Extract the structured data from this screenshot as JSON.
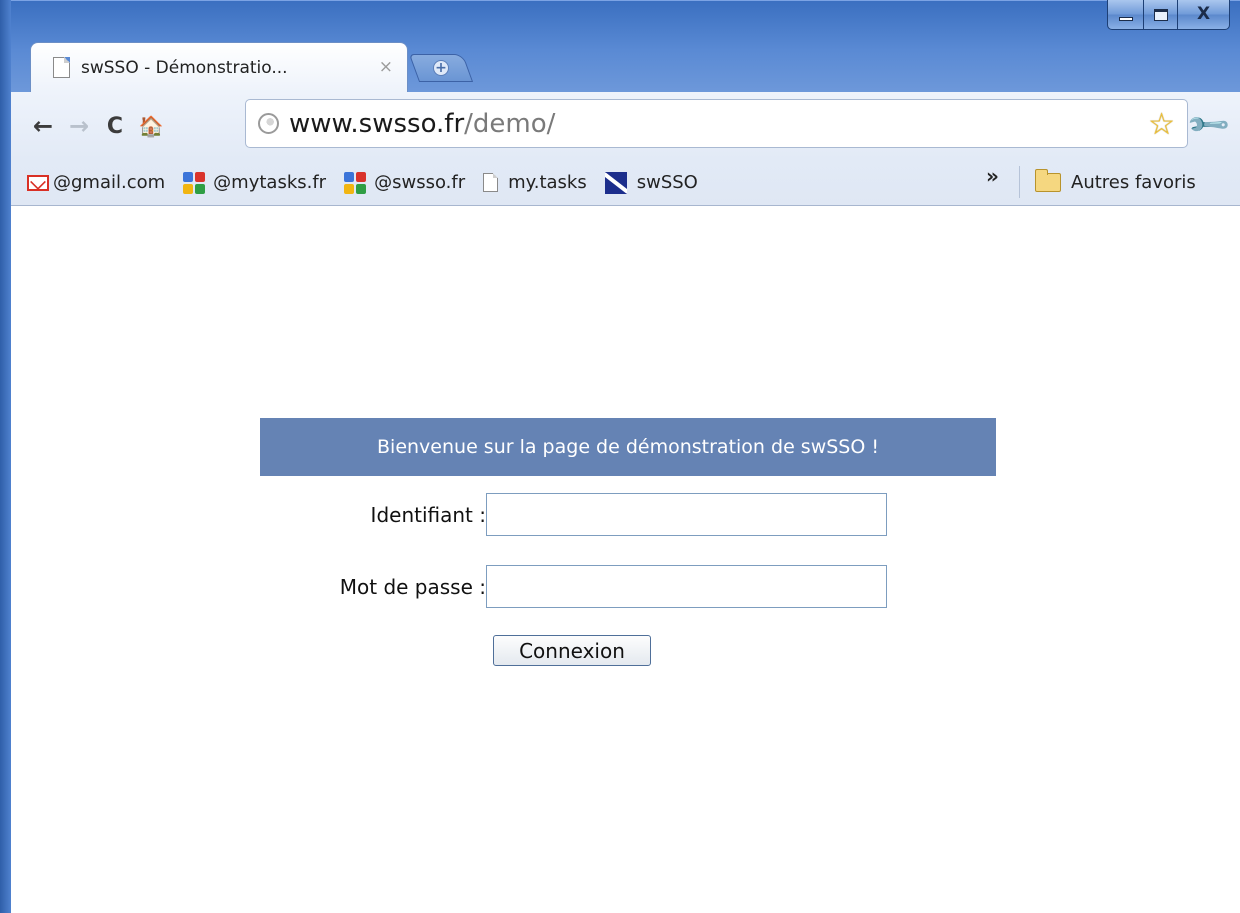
{
  "tab": {
    "title": "swSSO - Démonstratio...",
    "close": "×",
    "new_tab": "+"
  },
  "window": {
    "close": "X"
  },
  "toolbar": {
    "back": "←",
    "forward": "→",
    "reload": "C",
    "home": "🏠",
    "url_domain": "www.swsso.fr",
    "url_path": "/demo/",
    "star": "☆",
    "wrench": "🔧"
  },
  "bookmarks": {
    "items": [
      {
        "label": "@gmail.com",
        "icon": "gmail-icon"
      },
      {
        "label": "@mytasks.fr",
        "icon": "google-apps-icon"
      },
      {
        "label": "@swsso.fr",
        "icon": "google-apps-icon"
      },
      {
        "label": "my.tasks",
        "icon": "document-icon"
      },
      {
        "label": "swSSO",
        "icon": "swsso-icon"
      }
    ],
    "overflow": "»",
    "other": "Autres favoris"
  },
  "page": {
    "banner": "Bienvenue sur la page de démonstration de swSSO !",
    "login_label": "Identifiant :",
    "login_value": "",
    "password_label": "Mot de passe :",
    "password_value": "",
    "submit": "Connexion"
  },
  "colors": {
    "banner_bg": "#6583b4",
    "window_chrome": "#4f82cf"
  }
}
